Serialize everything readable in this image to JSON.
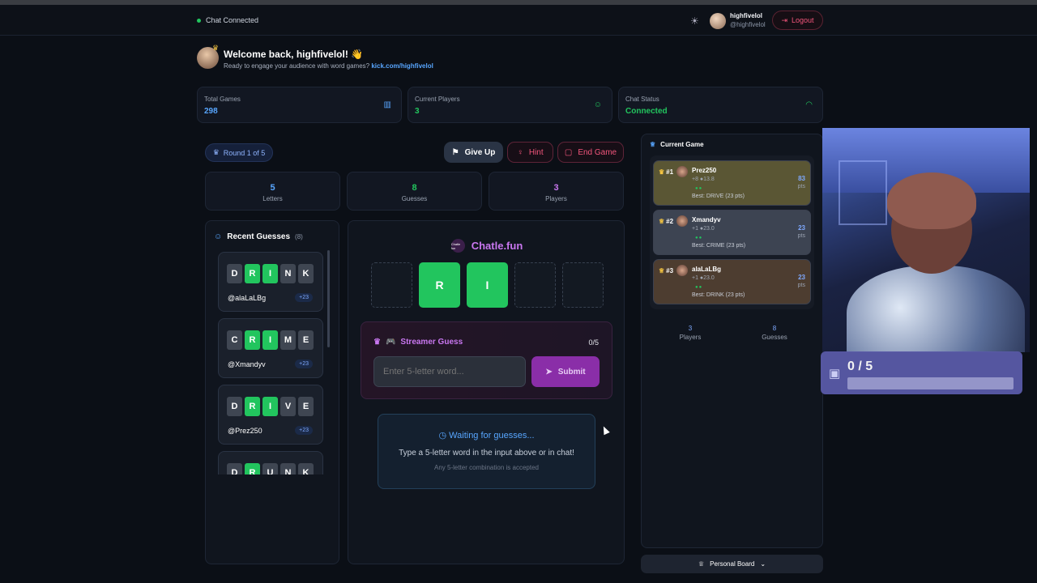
{
  "header": {
    "chat_status": "Chat Connected",
    "username": "highfivelol",
    "handle": "@highfivelol",
    "logout_label": "Logout"
  },
  "welcome": {
    "title": "Welcome back, highfivelol! 👋",
    "subtitle": "Ready to engage your audience with word games?",
    "link": "kick.com/highfivelol"
  },
  "stats": [
    {
      "label": "Total Games",
      "value": "298",
      "color": "#58a6ff",
      "icon": "bar-chart-icon"
    },
    {
      "label": "Current Players",
      "value": "3",
      "color": "#22c55e",
      "icon": "user-icon"
    },
    {
      "label": "Chat Status",
      "value": "Connected",
      "color": "#22c55e",
      "icon": "wifi-icon"
    }
  ],
  "round": {
    "label": "Round 1 of 5"
  },
  "actions": {
    "give_up": "Give Up",
    "hint": "Hint",
    "end_game": "End Game"
  },
  "game_stats": [
    {
      "value": "5",
      "label": "Letters",
      "color": "#58a6ff"
    },
    {
      "value": "8",
      "label": "Guesses",
      "color": "#22c55e"
    },
    {
      "value": "3",
      "label": "Players",
      "color": "#c977f0"
    }
  ],
  "recent": {
    "title": "Recent Guesses",
    "count": "(8)",
    "items": [
      {
        "letters": [
          "D",
          "R",
          "I",
          "N",
          "K"
        ],
        "correct": [
          false,
          true,
          true,
          false,
          false
        ],
        "user": "@alaLaLBg",
        "pts": "+23"
      },
      {
        "letters": [
          "C",
          "R",
          "I",
          "M",
          "E"
        ],
        "correct": [
          false,
          true,
          true,
          false,
          false
        ],
        "user": "@Xmandyv",
        "pts": "+23"
      },
      {
        "letters": [
          "D",
          "R",
          "I",
          "V",
          "E"
        ],
        "correct": [
          false,
          true,
          true,
          false,
          false
        ],
        "user": "@Prez250",
        "pts": "+23"
      },
      {
        "letters": [
          "D",
          "R",
          "U",
          "N",
          "K"
        ],
        "correct": [
          false,
          true,
          false,
          false,
          false
        ],
        "user": "",
        "pts": ""
      }
    ]
  },
  "brand": {
    "logo_text": "Chatle fun",
    "name": "Chatle.fun"
  },
  "board": {
    "tiles": [
      "",
      "R",
      "I",
      "",
      ""
    ],
    "correct": [
      false,
      true,
      true,
      false,
      false
    ]
  },
  "streamer_guess": {
    "title": "Streamer Guess",
    "count": "0/5",
    "placeholder": "Enter 5-letter word...",
    "submit": "Submit"
  },
  "waiting": {
    "title": "Waiting for guesses...",
    "line1": "Type a 5-letter word in the input above or in chat!",
    "line2": "Any 5-letter combination is accepted"
  },
  "current_game": {
    "title": "Current Game",
    "players": [
      {
        "rank": "#1",
        "name": "Prez250",
        "stats": "+8 ●13.8",
        "best": "Best: DRIVE (23 pts)",
        "pts": "83",
        "pts_label": "pts",
        "bg": "#5a5634",
        "dots": "●●"
      },
      {
        "rank": "#2",
        "name": "Xmandyv",
        "stats": "+1 ●23.0",
        "best": "Best: CRIME (23 pts)",
        "pts": "23",
        "pts_label": "pts",
        "bg": "#3d4452",
        "dots": "●●"
      },
      {
        "rank": "#3",
        "name": "alaLaLBg",
        "stats": "+1 ●23.0",
        "best": "Best: DRINK (23 pts)",
        "pts": "23",
        "pts_label": "pts",
        "bg": "#4d3d30",
        "dots": "●●"
      }
    ],
    "footer": [
      {
        "value": "3",
        "label": "Players"
      },
      {
        "value": "8",
        "label": "Guesses"
      }
    ]
  },
  "personal_board": {
    "label": "Personal Board"
  },
  "overlay": {
    "text": "0 / 5",
    "progress": 0
  }
}
